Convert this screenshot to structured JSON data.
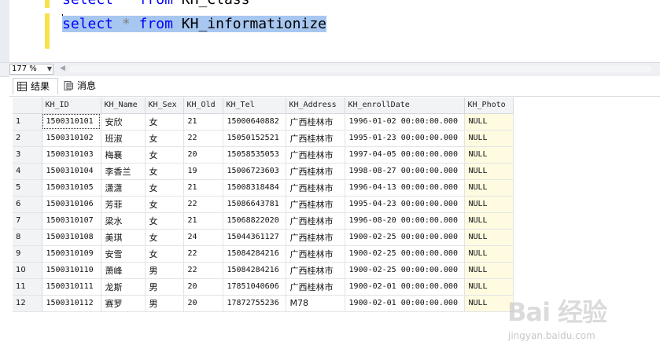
{
  "editor": {
    "line1": {
      "kw1": "select",
      "op": "*",
      "kw2": "from",
      "table": "KH_Class"
    },
    "line2": {
      "kw1": "select",
      "op": "*",
      "kw2": "from",
      "table": "KH_informationize"
    }
  },
  "zoom": {
    "value": "177 %"
  },
  "tabs": [
    {
      "label": "结果",
      "icon": "grid-icon"
    },
    {
      "label": "消息",
      "icon": "message-icon"
    }
  ],
  "grid": {
    "columns": [
      "KH_ID",
      "KH_Name",
      "KH_Sex",
      "KH_Old",
      "KH_Tel",
      "KH_Address",
      "KH_enrollDate",
      "KH_Photo"
    ],
    "rows": [
      {
        "n": "1",
        "id": "1500310101",
        "name": "安欣",
        "sex": "女",
        "old": "21",
        "tel": "15000640882",
        "addr": "广西桂林市",
        "date": "1996-01-02 00:00:00.000",
        "photo": "NULL"
      },
      {
        "n": "2",
        "id": "1500310102",
        "name": "班淑",
        "sex": "女",
        "old": "22",
        "tel": "15050152521",
        "addr": "广西桂林市",
        "date": "1995-01-23 00:00:00.000",
        "photo": "NULL"
      },
      {
        "n": "3",
        "id": "1500310103",
        "name": "梅襄",
        "sex": "女",
        "old": "20",
        "tel": "15058535053",
        "addr": "广西桂林市",
        "date": "1997-04-05 00:00:00.000",
        "photo": "NULL"
      },
      {
        "n": "4",
        "id": "1500310104",
        "name": "李香兰",
        "sex": "女",
        "old": "19",
        "tel": "15006723603",
        "addr": "广西桂林市",
        "date": "1998-08-27 00:00:00.000",
        "photo": "NULL"
      },
      {
        "n": "5",
        "id": "1500310105",
        "name": "潇潇",
        "sex": "女",
        "old": "21",
        "tel": "15008318484",
        "addr": "广西桂林市",
        "date": "1996-04-13 00:00:00.000",
        "photo": "NULL"
      },
      {
        "n": "6",
        "id": "1500310106",
        "name": "芳菲",
        "sex": "女",
        "old": "22",
        "tel": "15086643781",
        "addr": "广西桂林市",
        "date": "1995-04-23 00:00:00.000",
        "photo": "NULL"
      },
      {
        "n": "7",
        "id": "1500310107",
        "name": "梁水",
        "sex": "女",
        "old": "21",
        "tel": "15068822020",
        "addr": "广西桂林市",
        "date": "1996-08-20 00:00:00.000",
        "photo": "NULL"
      },
      {
        "n": "8",
        "id": "1500310108",
        "name": "美琪",
        "sex": "女",
        "old": "24",
        "tel": "15044361127",
        "addr": "广西桂林市",
        "date": "1900-02-25 00:00:00.000",
        "photo": "NULL"
      },
      {
        "n": "9",
        "id": "1500310109",
        "name": "安雪",
        "sex": "女",
        "old": "22",
        "tel": "15084284216",
        "addr": "广西桂林市",
        "date": "1900-02-25 00:00:00.000",
        "photo": "NULL"
      },
      {
        "n": "10",
        "id": "1500310110",
        "name": "萧峰",
        "sex": "男",
        "old": "22",
        "tel": "15084284216",
        "addr": "广西桂林市",
        "date": "1900-02-25 00:00:00.000",
        "photo": "NULL"
      },
      {
        "n": "11",
        "id": "1500310111",
        "name": "龙斯",
        "sex": "男",
        "old": "20",
        "tel": "17851040606",
        "addr": "广西桂林市",
        "date": "1900-02-01 00:00:00.000",
        "photo": "NULL"
      },
      {
        "n": "12",
        "id": "1500310112",
        "name": "赛罗",
        "sex": "男",
        "old": "20",
        "tel": "17872755236",
        "addr": "M78",
        "date": "1900-02-01 00:00:00.000",
        "photo": "NULL"
      }
    ]
  },
  "watermark": {
    "logo": "Bai 经验",
    "url": "jingyan.baidu.com"
  },
  "colors": {
    "keyword": "#0000ff",
    "selection": "#a7c7f0",
    "null_cell": "#fffbe0",
    "change_mark": "#f7e24a"
  }
}
